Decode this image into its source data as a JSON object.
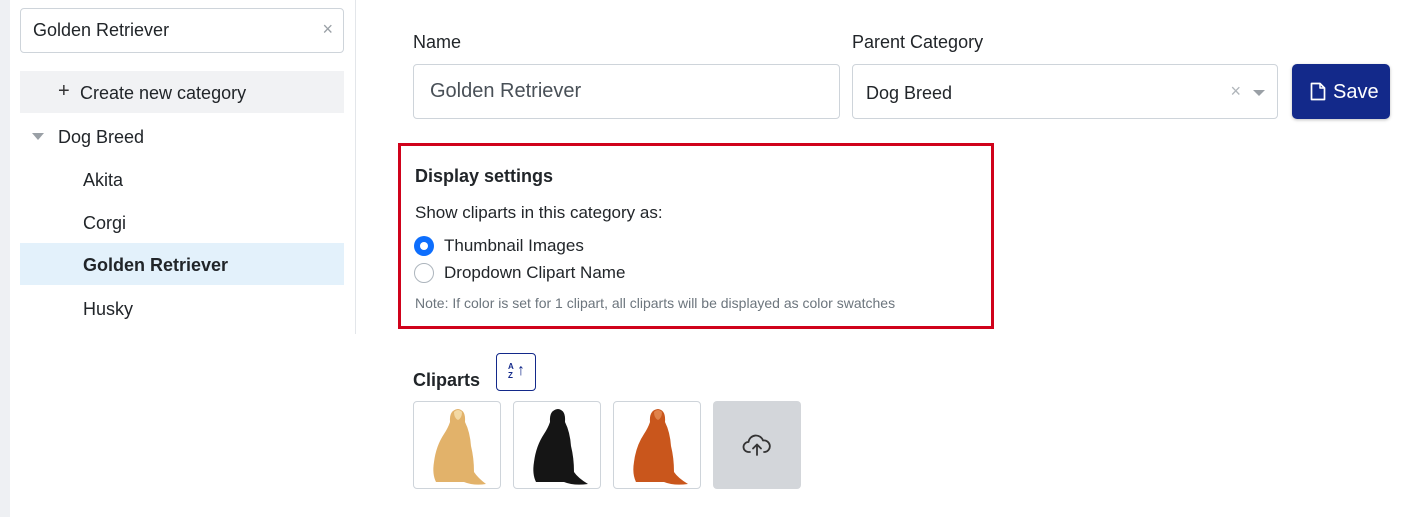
{
  "search": {
    "value": "Golden Retriever",
    "clear_icon": "×"
  },
  "sidebar": {
    "create_label": "Create new category",
    "create_icon": "+",
    "tree": [
      {
        "label": "Dog Breed",
        "level": 0,
        "expanded": true,
        "selected": false
      },
      {
        "label": "Akita",
        "level": 1,
        "selected": false
      },
      {
        "label": "Corgi",
        "level": 1,
        "selected": false
      },
      {
        "label": "Golden Retriever",
        "level": 1,
        "selected": true
      },
      {
        "label": "Husky",
        "level": 1,
        "selected": false
      }
    ]
  },
  "form": {
    "name_label": "Name",
    "name_value": "Golden Retriever",
    "parent_label": "Parent Category",
    "parent_value": "Dog Breed",
    "parent_clear_icon": "×",
    "save_label": "Save"
  },
  "display_settings": {
    "title": "Display settings",
    "subtitle": "Show cliparts in this category as:",
    "options": [
      {
        "label": "Thumbnail Images",
        "checked": true
      },
      {
        "label": "Dropdown Clipart Name",
        "checked": false
      }
    ],
    "note": "Note: If color is set for 1 clipart, all cliparts will be displayed as color swatches"
  },
  "cliparts": {
    "title": "Cliparts",
    "sort_icon": "sort-alpha-icon",
    "items": [
      {
        "icon": "golden-dog-icon",
        "color": "#e2b26a"
      },
      {
        "icon": "black-dog-icon",
        "color": "#151515"
      },
      {
        "icon": "red-dog-icon",
        "color": "#c9561c"
      }
    ],
    "upload_icon": "cloud-upload-icon"
  },
  "colors": {
    "primary": "#13298a",
    "highlight_border": "#d0021b",
    "selected_row": "#e3f1fb",
    "radio_checked": "#0d6efd"
  }
}
